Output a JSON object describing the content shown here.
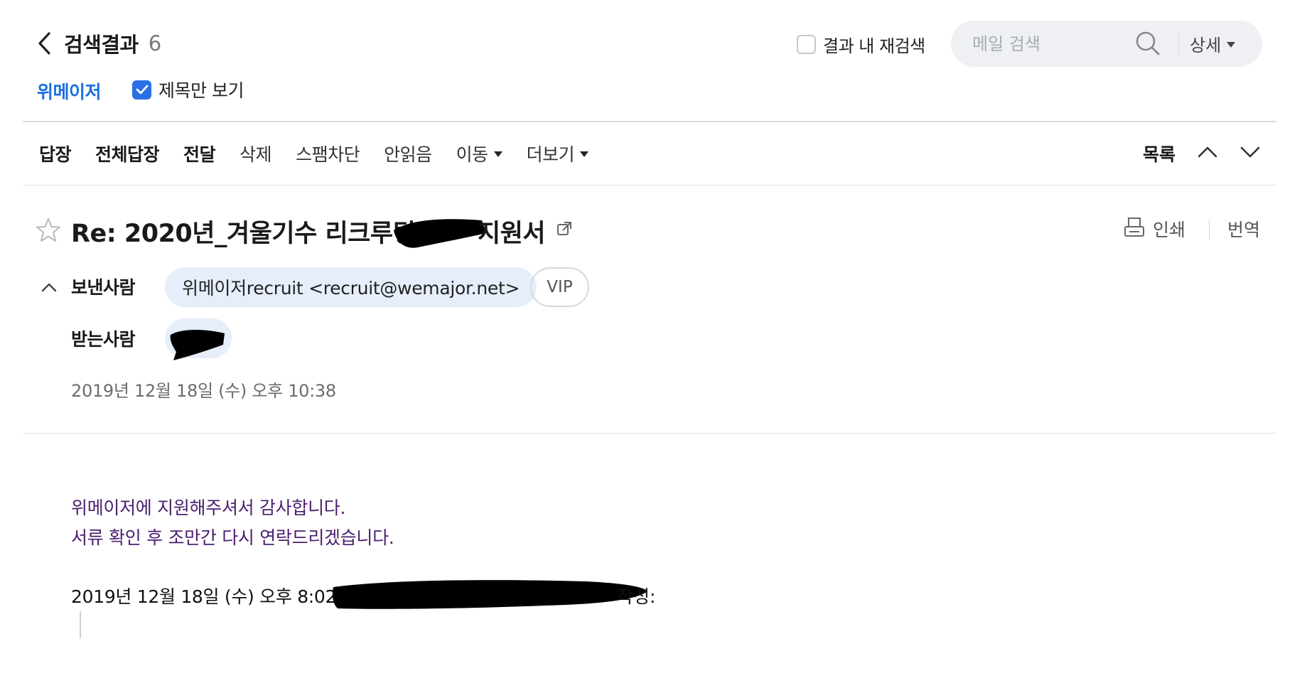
{
  "header": {
    "results_title": "검색결과",
    "results_count": "6",
    "re_search_label": "결과 내 재검색",
    "search_placeholder": "메일 검색",
    "detail_label": "상세",
    "folder_link": "위메이저",
    "subject_only_label": "제목만 보기"
  },
  "toolbar": {
    "reply": "답장",
    "reply_all": "전체답장",
    "forward": "전달",
    "delete": "삭제",
    "spam_block": "스팸차단",
    "mark_unread": "안읽음",
    "move": "이동",
    "more": "더보기",
    "list": "목록"
  },
  "message": {
    "subject_prefix": "Re: 2020년_겨울기수 리크루팅",
    "subject_suffix": "지원서",
    "print_label": "인쇄",
    "translate_label": "번역",
    "from_label": "보낸사람",
    "sender": "위메이저recruit <recruit@wemajor.net>",
    "vip_label": "VIP",
    "to_label": "받는사람",
    "date": "2019년 12월 18일 (수) 오후 10:38"
  },
  "body": {
    "lines": [
      "위메이저에 지원해주셔서 감사합니다.",
      "서류 확인 후 조만간 다시 연락드리겠습니다."
    ],
    "quote_prefix": "2019년 12월 18일 (수) 오후 8:02,",
    "quote_suffix": "작성:"
  },
  "colors": {
    "accent": "#1a6fe0",
    "checkbox": "#2a6fe6",
    "chip_bg": "#e6eefb",
    "search_bg": "#eef0f4",
    "body_text": "#4b1e6e"
  },
  "icons": [
    "back-chevron-icon",
    "search-icon",
    "caret-down-icon",
    "check-icon",
    "chevron-up-icon",
    "chevron-down-icon",
    "star-icon",
    "external-link-icon",
    "printer-icon"
  ]
}
